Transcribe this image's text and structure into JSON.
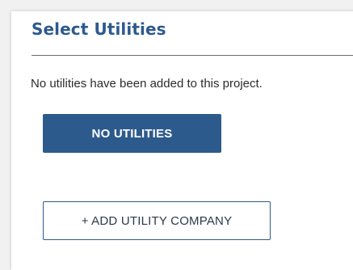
{
  "section": {
    "title": "Select Utilities",
    "empty_message": "No utilities have been added to this project."
  },
  "actions": {
    "no_utilities_label": "NO UTILITIES",
    "add_utility_label": "+ ADD UTILITY COMPANY"
  },
  "colors": {
    "primary": "#2d5a8c",
    "background": "#f1f1f1",
    "card": "#ffffff"
  }
}
